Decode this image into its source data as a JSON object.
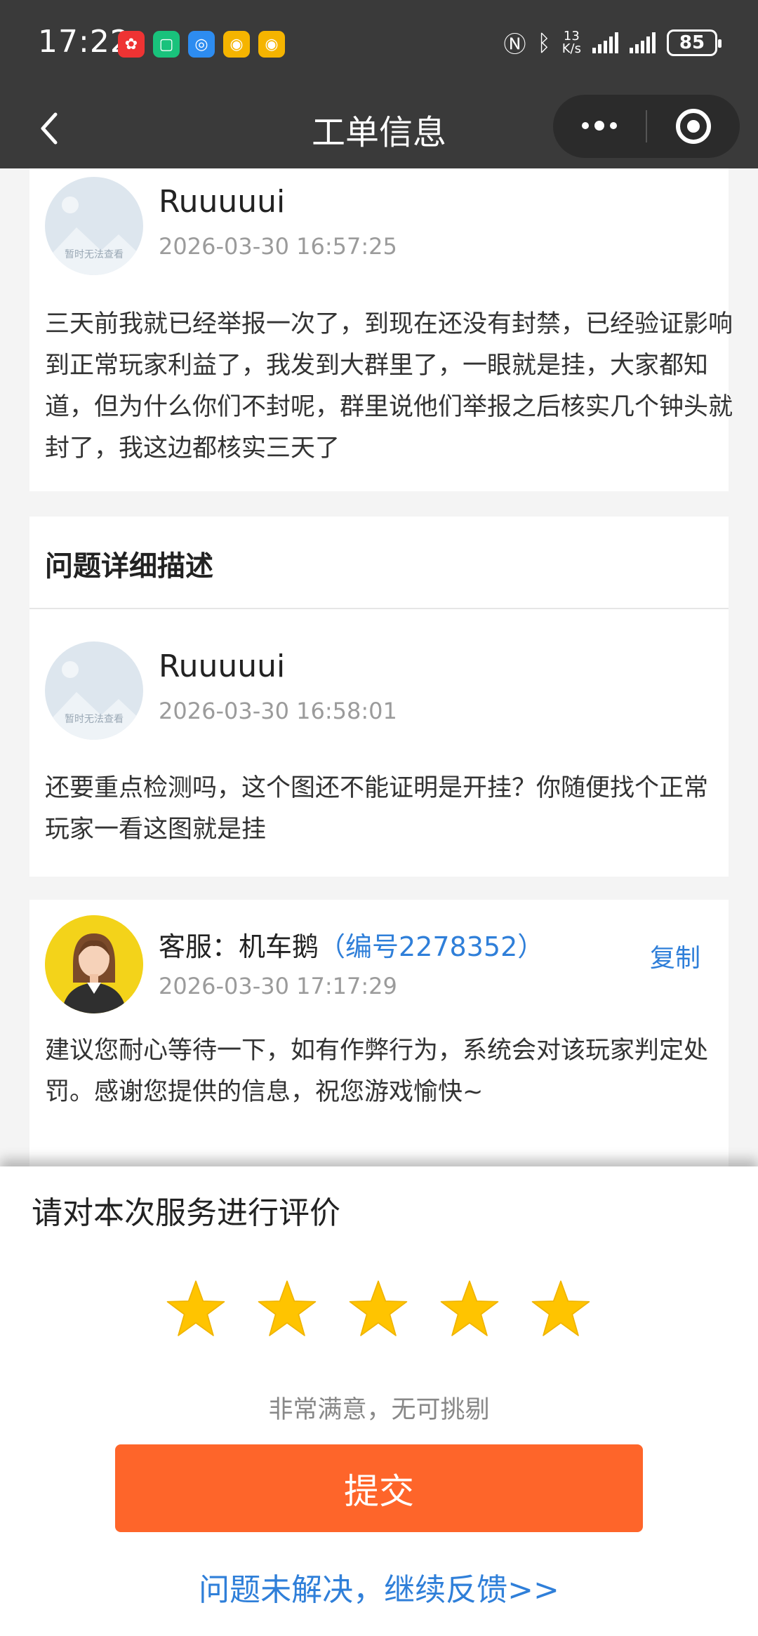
{
  "status_bar": {
    "time": "17:22",
    "speed_value": "13",
    "speed_unit": "K/s",
    "battery": "85"
  },
  "nav": {
    "title": "工单信息"
  },
  "messages": [
    {
      "name": "Ruuuuui",
      "time": "2026-03-30 16:57:25",
      "text": "三天前我就已经举报一次了，到现在还没有封禁，已经验证影响到正常玩家利益了，我发到大群里了，一眼就是挂，大家都知道，但为什么你们不封呢，群里说他们举报之后核实几个钟头就封了，我这边都核实三天了",
      "avatar_caption": "暂时无法查看"
    },
    {
      "name": "Ruuuuui",
      "time": "2026-03-30 16:58:01",
      "text": "还要重点检测吗，这个图还不能证明是开挂？你随便找个正常玩家一看这图就是挂",
      "avatar_caption": "暂时无法查看"
    },
    {
      "name_prefix": "客服：机车鹅",
      "staff_id": "（编号2278352）",
      "copy": "复制",
      "time": "2026-03-30 17:17:29",
      "text": "建议您耐心等待一下，如有作弊行为，系统会对该玩家判定处罚。感谢您提供的信息，祝您游戏愉快~"
    }
  ],
  "section": {
    "title": "问题详细描述"
  },
  "rating": {
    "title": "请对本次服务进行评价",
    "stars": 5,
    "max_stars": 5,
    "label": "非常满意，无可挑剔",
    "submit": "提交",
    "feedback_link": "问题未解决，继续反馈>>"
  },
  "colors": {
    "accent_blue": "#2f7fd9",
    "submit_orange": "#fe652a",
    "star": "#ffc400",
    "bar": "#3a3a3a"
  }
}
